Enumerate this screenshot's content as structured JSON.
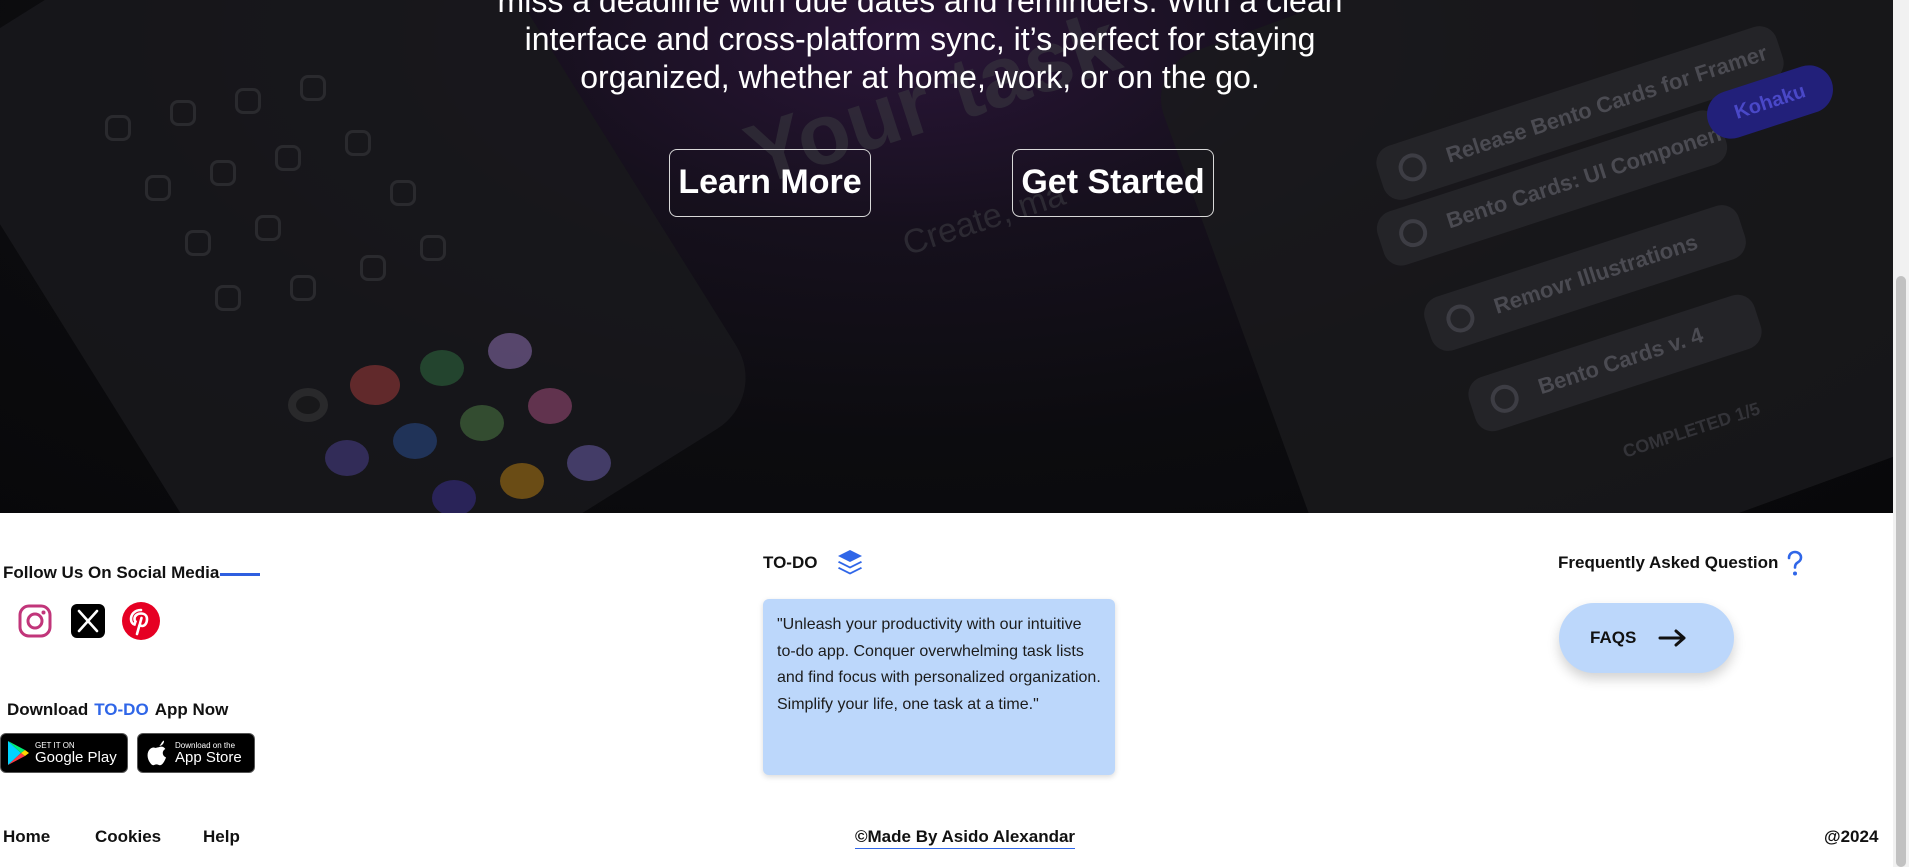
{
  "hero": {
    "text_line1": "miss a deadline with due dates and reminders. With a clean",
    "text_line2": "interface and cross-platform sync, it’s perfect for staying",
    "text_line3": "organized, whether at home, work, or on the go.",
    "learn_more": "Learn More",
    "get_started": "Get Started",
    "background_texts": {
      "ghost_title": "Your task",
      "ghost_sub": "Create, ma",
      "task_1": "Release Bento Cards for Framer",
      "task_2": "Bento Cards: UI Componen",
      "task_3": "Removr Illustrations",
      "task_4": "Bento Cards v. 4",
      "kohaku": "Kohaku",
      "completed": "COMPLETED  1/5"
    }
  },
  "footer": {
    "follow_title": "Follow Us On Social Media",
    "social": [
      {
        "icon": "instagram-icon",
        "color": "#c1357a"
      },
      {
        "icon": "x-icon",
        "color": "#000000"
      },
      {
        "icon": "pinterest-icon",
        "color": "#e60023"
      }
    ],
    "download_prefix": "Download",
    "download_brand": "TO-DO",
    "download_suffix": "App Now",
    "google_play_small": "GET IT ON",
    "google_play_big": "Google Play",
    "app_store_small": "Download on the",
    "app_store_big": "App Store",
    "todo_title": "TO-DO",
    "quote": "\"Unleash your productivity with our intuitive to-do app. Conquer overwhelming task lists and find focus with personalized organization. Simplify your life, one task at a time.\"",
    "faq_title": "Frequently Asked Question",
    "faq_button": "FAQS"
  },
  "bottom": {
    "home": "Home",
    "cookies": "Cookies",
    "help": "Help",
    "credit": "©Made By Asido Alexandar",
    "year": "@2024"
  },
  "colors": {
    "accent": "#2f66e8",
    "light_blue": "#bcd7fb",
    "hero_bg": "#0c0c0f"
  }
}
